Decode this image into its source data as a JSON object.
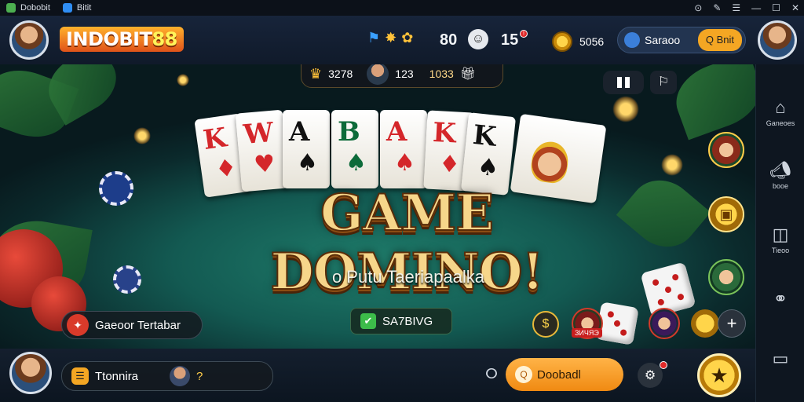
{
  "window": {
    "tabs": [
      {
        "label": "Dobobit",
        "icon": "app-icon"
      },
      {
        "label": "Bitit",
        "icon": "water-drop-icon"
      }
    ],
    "controls": [
      "clock-icon",
      "pin-icon",
      "menu-icon",
      "minimize-icon",
      "maximize-icon",
      "close-icon"
    ]
  },
  "topbar": {
    "logo_main": "INDOBIT",
    "logo_num": "88",
    "stat_a": "80",
    "stat_b": "15",
    "coins": "5056",
    "search_label": "Saraoo",
    "search_button": "Q Bnit",
    "notif_badge": "!"
  },
  "hud": {
    "chips_left": "3278",
    "chips_right": "123",
    "bonus": "1033"
  },
  "cards": [
    {
      "rank": "K",
      "suit": "♦",
      "color": "red"
    },
    {
      "rank": "W",
      "suit": "♥",
      "color": "red"
    },
    {
      "rank": "A",
      "suit": "♠",
      "color": "blk"
    },
    {
      "rank": "B",
      "suit": "♠",
      "color": "grn"
    },
    {
      "rank": "A",
      "suit": "♠",
      "color": "red"
    },
    {
      "rank": "K",
      "suit": "♦",
      "color": "red"
    },
    {
      "rank": "K",
      "suit": "♠",
      "color": "blk"
    }
  ],
  "main": {
    "title": "GAME DOMINO!",
    "subtitle": "o Putu Taeriapaalka",
    "left_button": "Gaeoor Tertabar",
    "center_button": "SA7BIVG",
    "player_tag": "ЗИЧЯЭ"
  },
  "sidebar": {
    "items": [
      {
        "label": "Ganeoes",
        "icon": "home-icon"
      },
      {
        "label": "booe",
        "icon": "megaphone-icon"
      },
      {
        "label": "Tieoo",
        "icon": "calendar-icon"
      },
      {
        "label": "",
        "icon": "link-icon"
      },
      {
        "label": "",
        "icon": "folder-icon"
      }
    ]
  },
  "bottombar": {
    "tournament_label": "Ttonnira",
    "player_count": "?",
    "download_label": "Doobadl",
    "loading_glyph": "ⵔ"
  },
  "colors": {
    "accent_orange": "#f4a623",
    "table_green": "#1f7d6b",
    "topbar_bg": "#17243a",
    "red_badge": "#e02a2a"
  }
}
